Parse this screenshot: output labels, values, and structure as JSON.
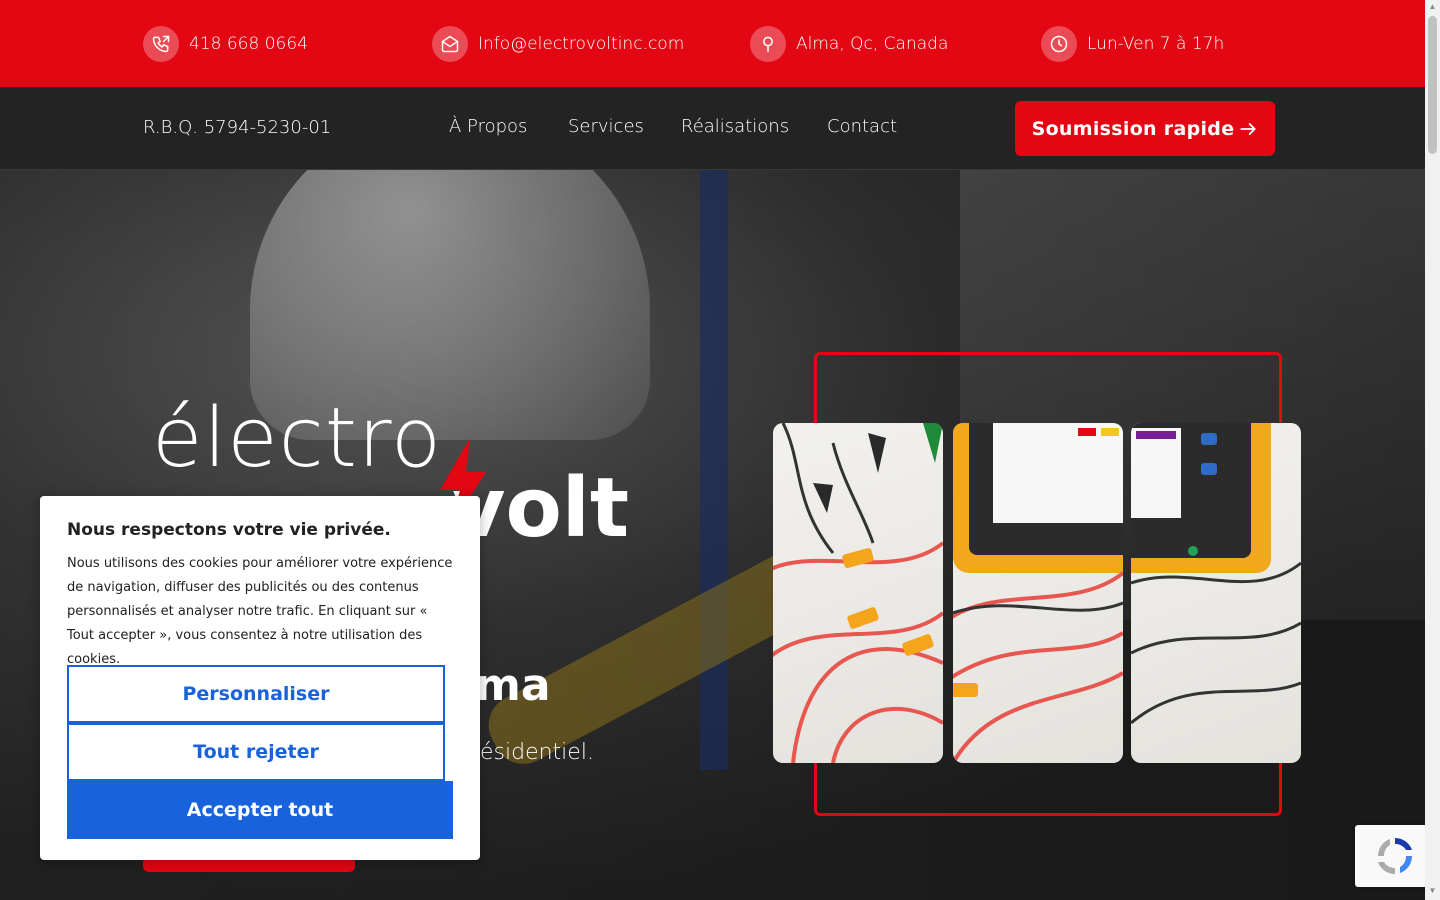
{
  "topbar": {
    "phone": "418 668 0664",
    "email": "Info@electrovoltinc.com",
    "location": "Alma, Qc, Canada",
    "hours": "Lun-Ven 7 à 17h",
    "icons": [
      "phone-icon",
      "mail-icon",
      "location-pin-icon",
      "clock-icon"
    ],
    "background": "#e30613"
  },
  "nav": {
    "rbq": "R.B.Q. 5794-5230-01",
    "links": [
      "À Propos",
      "Services",
      "Réalisations",
      "Contact"
    ],
    "cta_label": "Soumission rapide"
  },
  "hero": {
    "logo_line1": "électro",
    "logo_line2": "volt",
    "title_visible": "ma",
    "subtitle_visible": "ésidentiel."
  },
  "cookie": {
    "title": "Nous respectons votre vie privée.",
    "body": "Nous utilisons des cookies pour améliorer votre expérience de navigation, diffuser des publicités ou des contenus personnalisés et analyser notre trafic. En cliquant sur « Tout accepter », vous consentez à notre utilisation des cookies.",
    "customize_label": "Personnaliser",
    "reject_label": "Tout rejeter",
    "accept_label": "Accepter tout",
    "accent": "#1863dc"
  }
}
